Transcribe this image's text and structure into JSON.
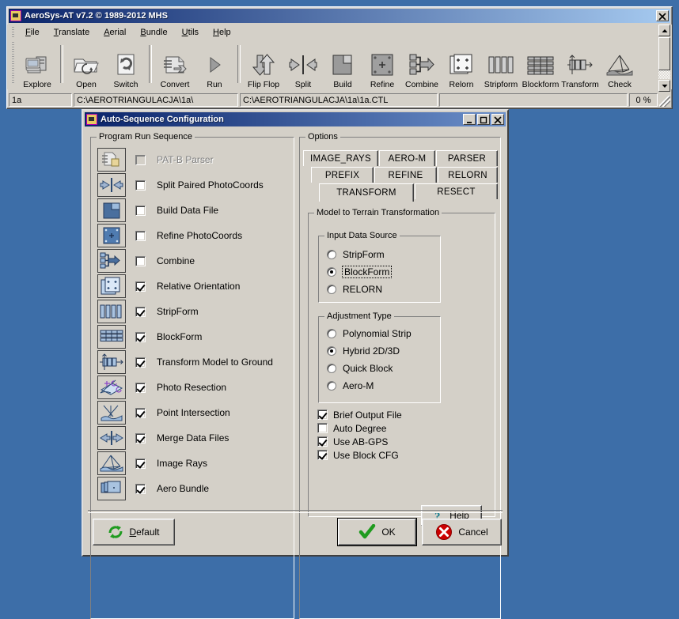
{
  "app": {
    "title": "AeroSys-AT  v7.2 © 1989-2012 MHS",
    "window_buttons": {
      "close": "✕"
    },
    "menu": [
      {
        "label": "File",
        "accel": "F"
      },
      {
        "label": "Translate",
        "accel": "T"
      },
      {
        "label": "Aerial",
        "accel": "A"
      },
      {
        "label": "Bundle",
        "accel": "B"
      },
      {
        "label": "Utils",
        "accel": "U"
      },
      {
        "label": "Help",
        "accel": "H"
      }
    ],
    "toolbar": [
      {
        "label": "Explore",
        "icon": "computer-icon"
      },
      {
        "sep": true
      },
      {
        "label": "Open",
        "icon": "open-folder-icon"
      },
      {
        "label": "Switch",
        "icon": "switch-page-icon"
      },
      {
        "sep": true
      },
      {
        "label": "Convert",
        "icon": "convert-icon"
      },
      {
        "label": "Run",
        "icon": "run-play-icon"
      },
      {
        "sep": true
      },
      {
        "label": "Flip Flop",
        "icon": "flip-flop-icon"
      },
      {
        "label": "Split",
        "icon": "split-icon"
      },
      {
        "label": "Build",
        "icon": "build-icon"
      },
      {
        "label": "Refine",
        "icon": "refine-icon"
      },
      {
        "label": "Combine",
        "icon": "combine-icon"
      },
      {
        "label": "Relorn",
        "icon": "relorn-icon"
      },
      {
        "label": "Stripform",
        "icon": "stripform-icon"
      },
      {
        "label": "Blockform",
        "icon": "blockform-icon"
      },
      {
        "label": "Transform",
        "icon": "transform-icon"
      },
      {
        "label": "Check",
        "icon": "check-rays-icon"
      }
    ],
    "statusbar": {
      "project": "1a",
      "path": "C:\\AEROTRIANGULACJA\\1a\\",
      "control_file": "C:\\AEROTRIANGULACJA\\1a\\1a.CTL",
      "blank": "",
      "progress": "0 %"
    }
  },
  "dialog": {
    "title": "Auto-Sequence Configuration",
    "window_buttons": {
      "minimize": "_",
      "maximize": "❐",
      "close": "✕"
    },
    "sequence_group": {
      "label": "Program Run Sequence"
    },
    "sequence_items": [
      {
        "label": "PAT-B  Parser",
        "checked": false,
        "disabled": true,
        "icon": "parser-icon"
      },
      {
        "label": "Split Paired PhotoCoords",
        "checked": false,
        "disabled": false,
        "icon": "split-icon"
      },
      {
        "label": "Build Data File",
        "checked": false,
        "disabled": false,
        "icon": "build-icon"
      },
      {
        "label": "Refine PhotoCoords",
        "checked": false,
        "disabled": false,
        "icon": "refine-icon"
      },
      {
        "label": "Combine",
        "checked": false,
        "disabled": false,
        "icon": "combine-icon"
      },
      {
        "label": "Relative Orientation",
        "checked": true,
        "disabled": false,
        "icon": "relorn-icon"
      },
      {
        "label": "StripForm",
        "checked": true,
        "disabled": false,
        "icon": "stripform-icon"
      },
      {
        "label": "BlockForm",
        "checked": true,
        "disabled": false,
        "icon": "blockform-icon"
      },
      {
        "label": "Transform Model to Ground",
        "checked": true,
        "disabled": false,
        "icon": "transform-icon"
      },
      {
        "label": "Photo Resection",
        "checked": true,
        "disabled": false,
        "icon": "resection-icon"
      },
      {
        "label": "Point Intersection",
        "checked": true,
        "disabled": false,
        "icon": "intersection-icon"
      },
      {
        "label": "Merge Data Files",
        "checked": true,
        "disabled": false,
        "icon": "merge-icon"
      },
      {
        "label": "Image Rays",
        "checked": true,
        "disabled": false,
        "icon": "image-rays-icon"
      },
      {
        "label": "Aero Bundle",
        "checked": true,
        "disabled": false,
        "icon": "aero-bundle-icon"
      }
    ],
    "options_group": {
      "label": "Options"
    },
    "tabs_row1": [
      {
        "label": "IMAGE_RAYS",
        "selected": false
      },
      {
        "label": "AERO-M",
        "selected": false
      },
      {
        "label": "PARSER",
        "selected": false
      }
    ],
    "tabs_row2": [
      {
        "label": "PREFIX",
        "selected": false
      },
      {
        "label": "REFINE",
        "selected": false
      },
      {
        "label": "RELORN",
        "selected": false
      }
    ],
    "tabs_row3": [
      {
        "label": "TRANSFORM",
        "selected": true
      },
      {
        "label": "RESECT",
        "selected": false
      }
    ],
    "transform_group": {
      "label": "Model to Terrain Transformation"
    },
    "input_data_source": {
      "label": "Input Data Source",
      "options": [
        {
          "label": "StripForm",
          "selected": false,
          "focused": false
        },
        {
          "label": "BlockForm",
          "selected": true,
          "focused": true
        },
        {
          "label": "RELORN",
          "selected": false,
          "focused": false
        }
      ]
    },
    "adjustment_type": {
      "label": "Adjustment Type",
      "options": [
        {
          "label": "Polynomial Strip",
          "selected": false
        },
        {
          "label": "Hybrid 2D/3D",
          "selected": true
        },
        {
          "label": "Quick Block",
          "selected": false
        },
        {
          "label": "Aero-M",
          "selected": false
        }
      ]
    },
    "flags": [
      {
        "label": "Brief Output File",
        "checked": true
      },
      {
        "label": "Auto Degree",
        "checked": false
      },
      {
        "label": "Use AB-GPS",
        "checked": true
      },
      {
        "label": "Use Block CFG",
        "checked": true
      }
    ],
    "help_button": {
      "label": "Help",
      "accel": "H",
      "icon": "question-mark-icon"
    },
    "default_button": {
      "label": "Default",
      "accel": "D",
      "icon": "refresh-arrows-icon"
    },
    "ok_button": {
      "label": "OK",
      "icon": "green-check-icon"
    },
    "cancel_button": {
      "label": "Cancel",
      "icon": "red-x-circle-icon"
    }
  },
  "colors": {
    "face": "#d4d0c8",
    "desktop": "#3d6ea8",
    "title_active": "#0a246a",
    "icon_blue": "#4a6f9e",
    "accent_green": "#1f9b1f",
    "accent_red": "#cc0000"
  }
}
